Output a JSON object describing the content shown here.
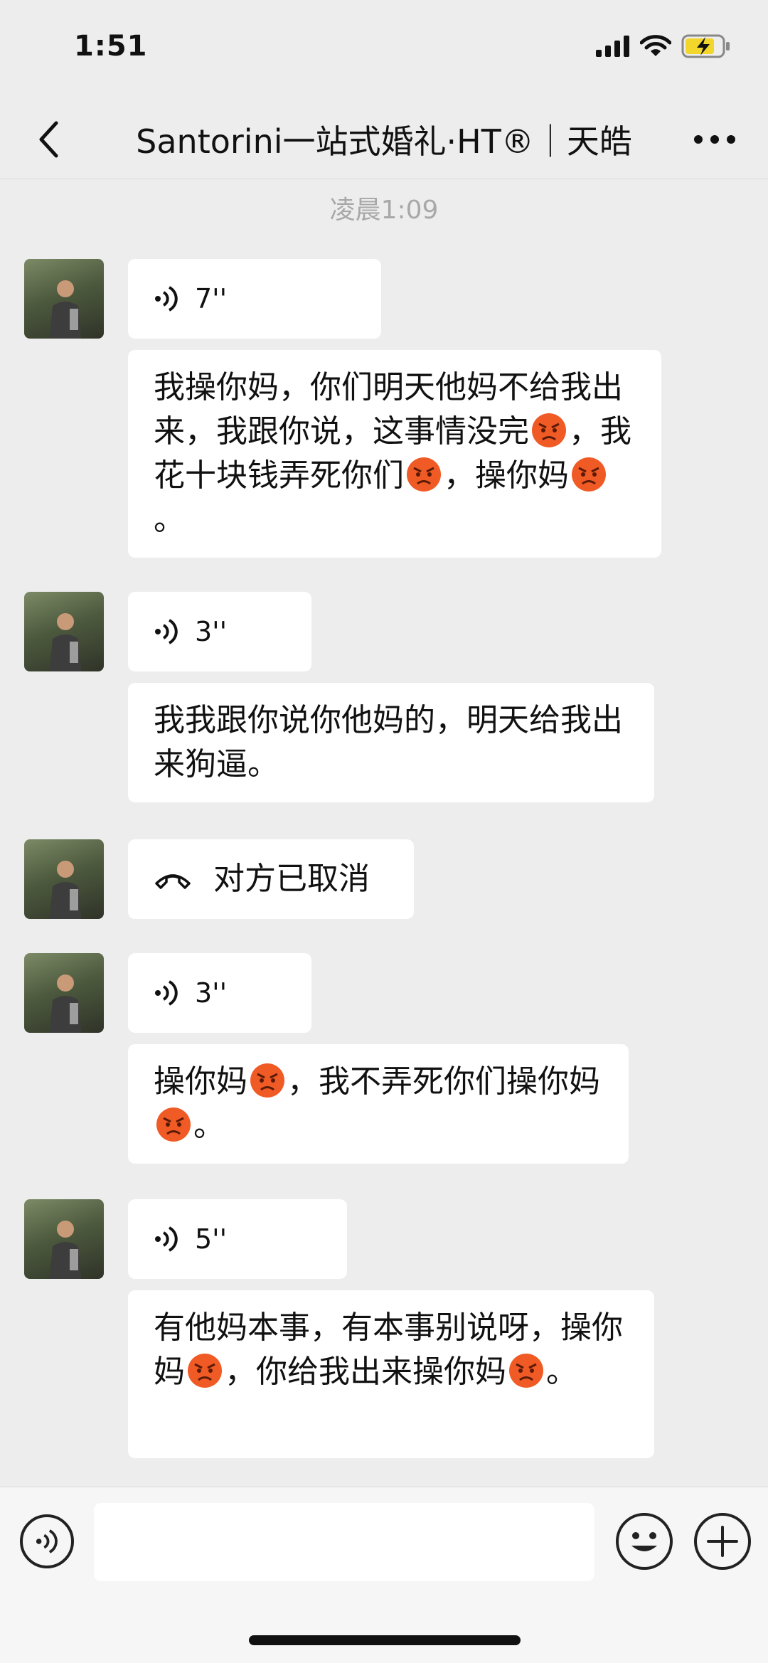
{
  "status_bar": {
    "time": "1:51"
  },
  "nav": {
    "title": "Santorini一站式婚礼·HT®｜天皓"
  },
  "chat": {
    "timestamp": "凌晨1:09",
    "messages": [
      {
        "type": "voice",
        "duration": "7''"
      },
      {
        "type": "text",
        "parts": [
          "我操你妈，你们明天他妈不给我出来，我跟你说，这事情没完",
          "，我花十块钱弄死你们",
          "，操你妈",
          "。"
        ]
      },
      {
        "type": "voice",
        "duration": "3''"
      },
      {
        "type": "text",
        "parts": [
          "我我跟你说你他妈的，明天给我出来狗逼。"
        ]
      },
      {
        "type": "call",
        "text": "对方已取消"
      },
      {
        "type": "voice",
        "duration": "3''"
      },
      {
        "type": "text",
        "parts": [
          "操你妈",
          "，我不弄死你们操你妈",
          "。"
        ]
      },
      {
        "type": "voice",
        "duration": "5''"
      },
      {
        "type": "text",
        "parts": [
          "有他妈本事，有本事别说呀，操你妈",
          "，你给我出来操你妈",
          "。"
        ]
      }
    ]
  },
  "input_bar": {
    "placeholder": ""
  },
  "icons": {
    "back": "chevron-left-icon",
    "more": "more-dots-icon",
    "voice": "voice-wave-icon",
    "call": "phone-hangup-icon",
    "emoji": "angry-face-emoji",
    "smiley": "smiley-icon",
    "plus": "plus-icon"
  },
  "colors": {
    "background": "#ededed",
    "bubble": "#ffffff",
    "timestamp": "#a8a8a8",
    "emoji": "#f05a24"
  }
}
